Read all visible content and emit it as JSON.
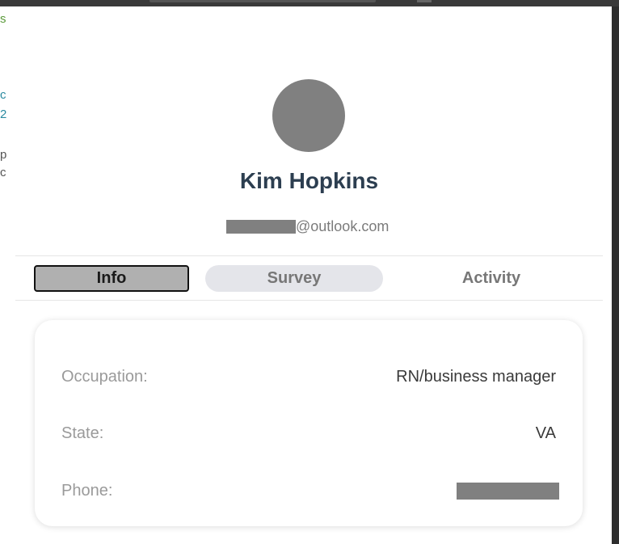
{
  "background_glyphs": {
    "g1": "s",
    "g2": "c",
    "g3": "2",
    "g4": "p",
    "g5": "c"
  },
  "profile": {
    "name": "Kim Hopkins",
    "email_domain": "@outlook.com"
  },
  "tabs": [
    {
      "label": "Info",
      "active": true
    },
    {
      "label": "Survey",
      "active": false
    },
    {
      "label": "Activity",
      "active": false
    }
  ],
  "info": {
    "occupation_label": "Occupation:",
    "occupation_value": "RN/business manager",
    "state_label": "State:",
    "state_value": "VA",
    "phone_label": "Phone:"
  },
  "colors": {
    "avatar": "#808080",
    "name": "#2c3e50",
    "active_tab_bg": "#b0b0b0",
    "survey_tab_bg": "#e4e5ea",
    "redaction": "#808080"
  }
}
